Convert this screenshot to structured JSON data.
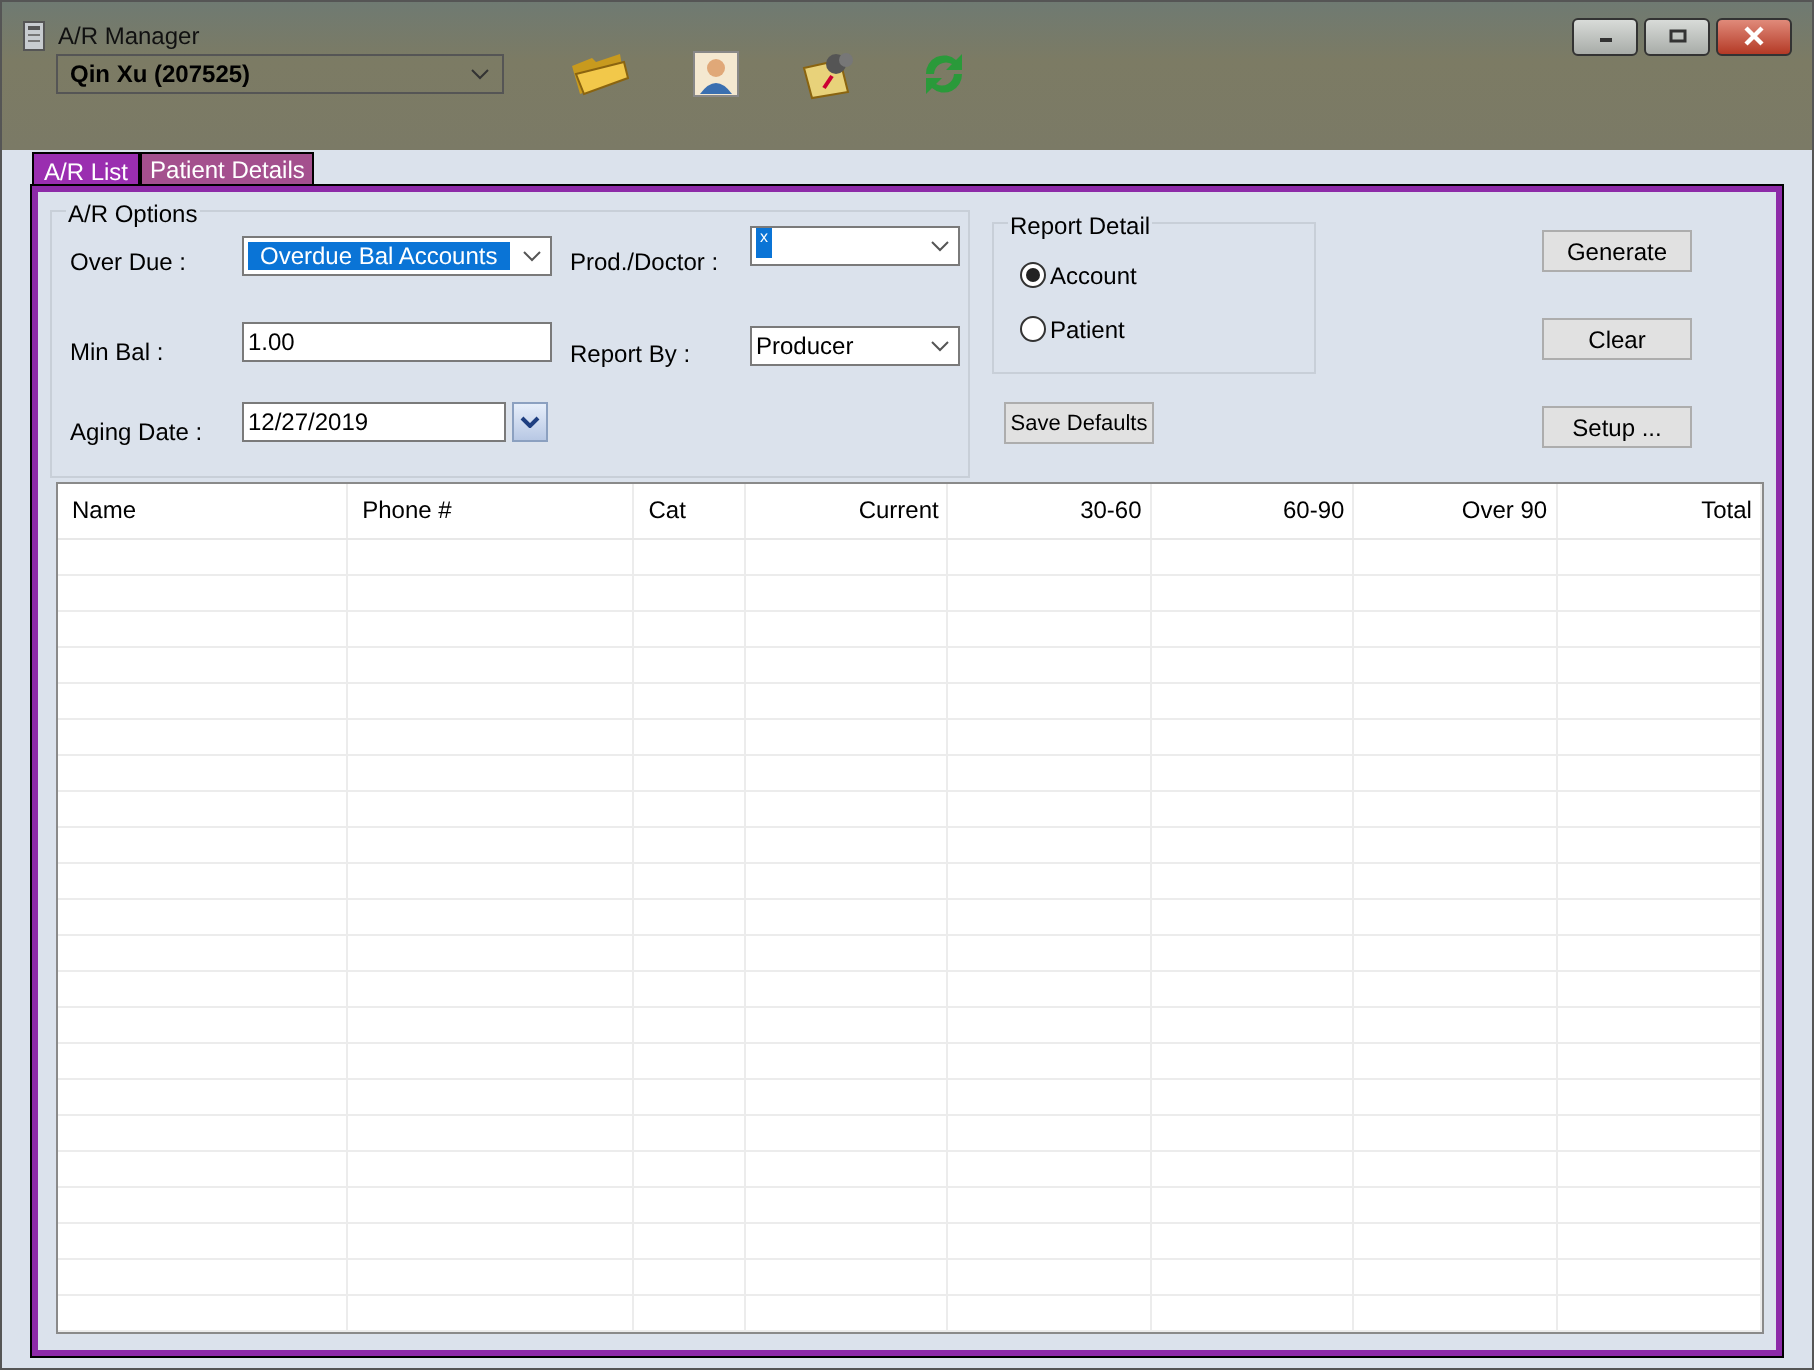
{
  "window": {
    "title": "A/R Manager"
  },
  "patient_select": {
    "value": "Qin Xu (207525)"
  },
  "tabs": [
    {
      "label": "A/R List",
      "selected": true
    },
    {
      "label": "Patient Details",
      "selected": false
    }
  ],
  "ar_options": {
    "title": "A/R Options",
    "over_due": {
      "label": "Over Due :",
      "value": "Overdue Bal Accounts"
    },
    "min_bal": {
      "label": "Min Bal :",
      "value": "1.00"
    },
    "aging_date": {
      "label": "Aging Date :",
      "value": "12/27/2019"
    },
    "prod_doctor": {
      "label": "Prod./Doctor :",
      "value": "x"
    },
    "report_by": {
      "label": "Report By :",
      "value": "Producer"
    }
  },
  "report_detail": {
    "title": "Report Detail",
    "options": [
      {
        "label": "Account",
        "selected": true
      },
      {
        "label": "Patient",
        "selected": false
      }
    ]
  },
  "buttons": {
    "save_defaults": "Save Defaults",
    "generate": "Generate",
    "clear": "Clear",
    "setup": "Setup ..."
  },
  "table": {
    "columns": [
      {
        "label": "Name"
      },
      {
        "label": "Phone #"
      },
      {
        "label": "Cat"
      },
      {
        "label": "Current"
      },
      {
        "label": "30-60"
      },
      {
        "label": "60-90"
      },
      {
        "label": "Over 90"
      },
      {
        "label": "Total"
      }
    ]
  }
}
